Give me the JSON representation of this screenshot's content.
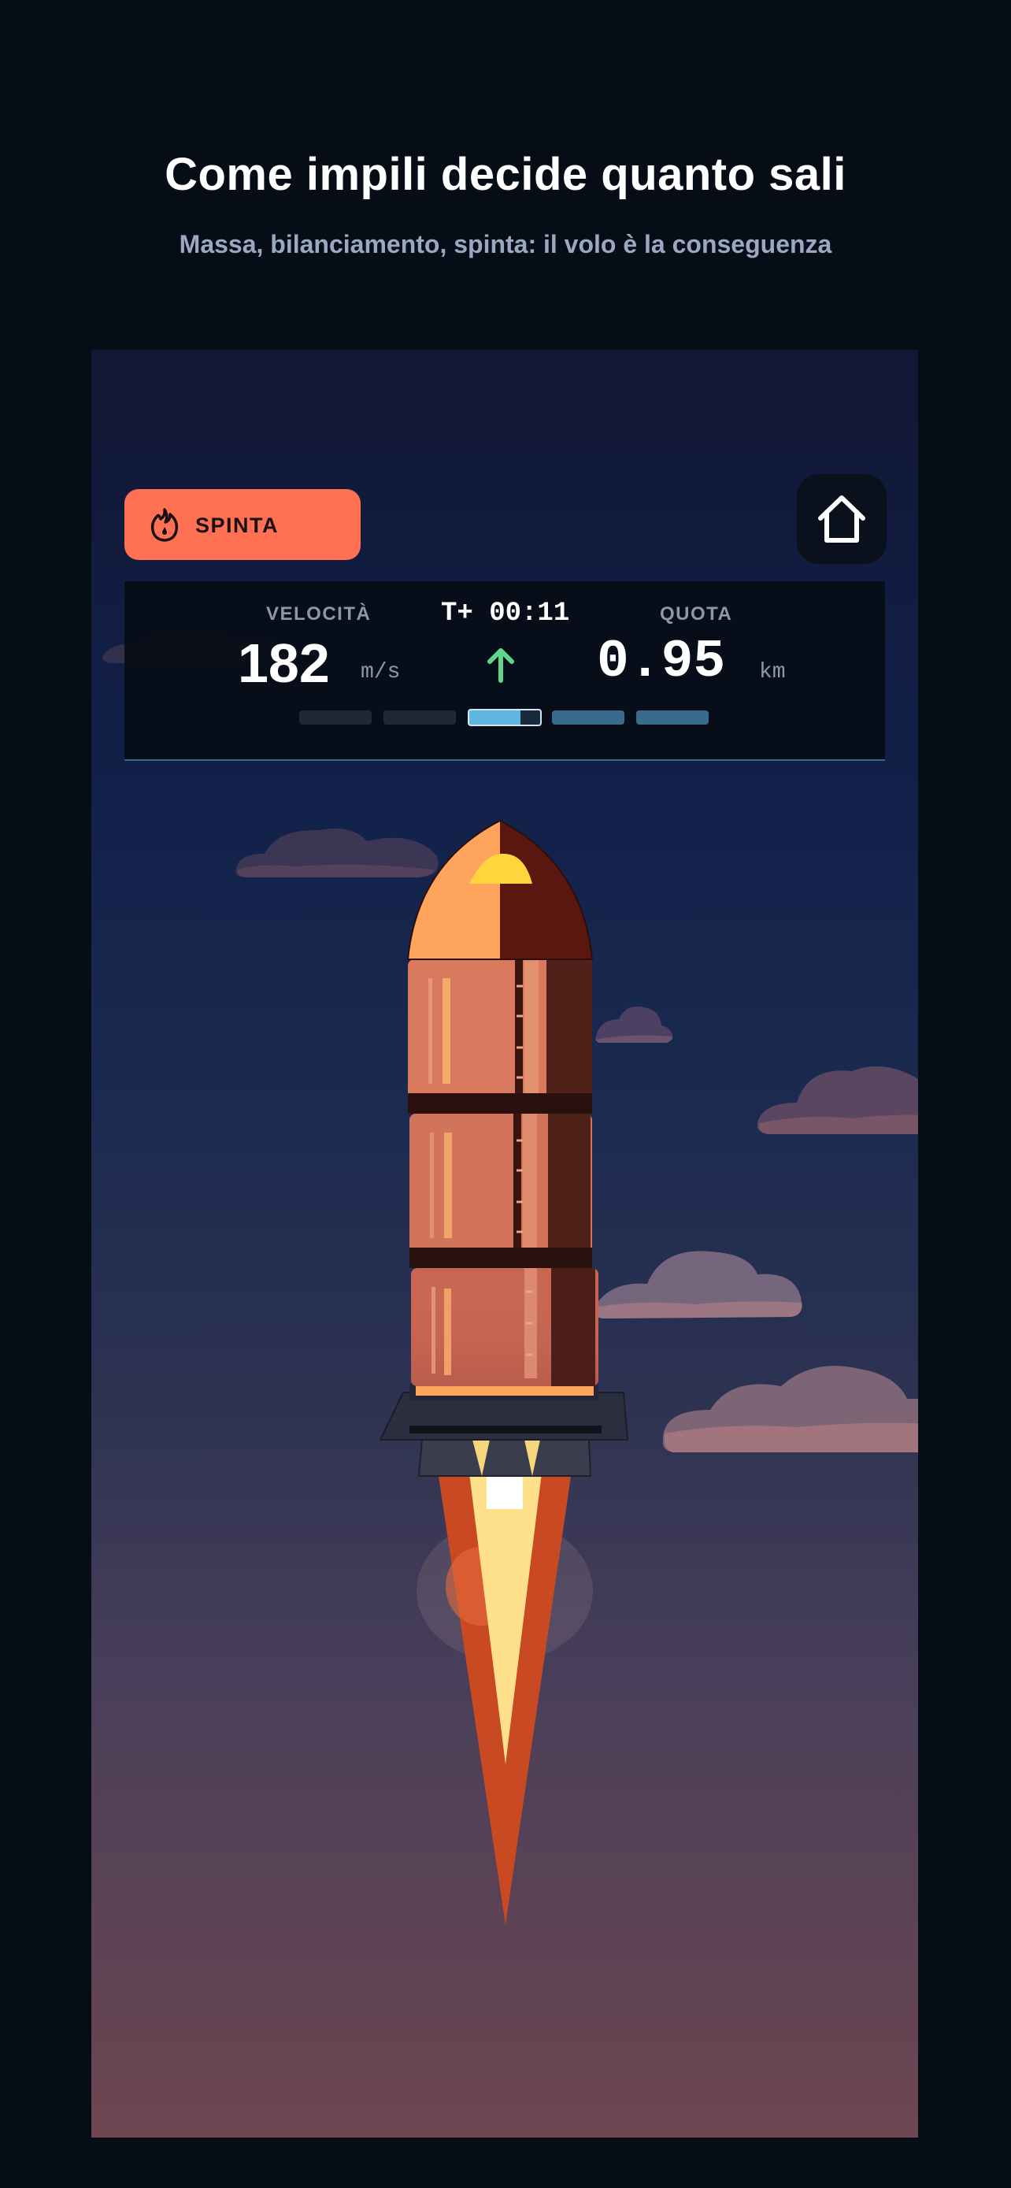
{
  "header": {
    "title": "Come impili decide quanto sali",
    "subtitle": "Massa, bilanciamento, spinta: il volo è la conseguenza"
  },
  "controls": {
    "thrust_label": "SPINTA",
    "thrust_icon": "flame-icon",
    "home_icon": "home-icon"
  },
  "hud": {
    "velocity_label": "VELOCITÀ",
    "velocity_value": "182",
    "velocity_unit": "m/s",
    "timer": "T+ 00:11",
    "trend_icon": "arrow-up-icon",
    "altitude_label": "QUOTA",
    "altitude_value": "0.95",
    "altitude_unit": "km",
    "stages": [
      {
        "state": "empty",
        "color": "#1e2836"
      },
      {
        "state": "empty",
        "color": "#1e2836"
      },
      {
        "state": "active",
        "color": "#5fb7e0"
      },
      {
        "state": "ahead",
        "color": "#3a6b8c"
      },
      {
        "state": "ahead",
        "color": "#3a6b8c"
      }
    ]
  },
  "rocket": {
    "stack_height_modules": 3,
    "colors": {
      "nose_light": "#ffa45c",
      "nose_dark": "#5a1710",
      "window": "#ffd43c",
      "module": "#d97a5f",
      "module_dark": "#4e2119",
      "flame_outer": "#c94a22",
      "flame_inner": "#ffe08a"
    }
  }
}
